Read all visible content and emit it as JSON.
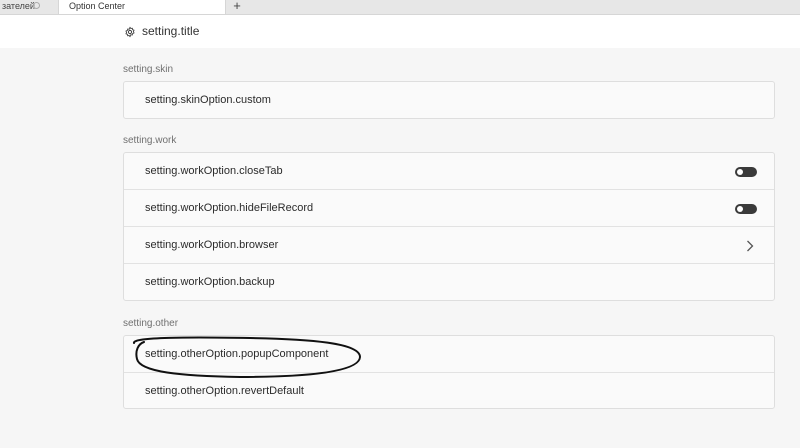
{
  "tabs": {
    "inactive_label": "зателей",
    "active_label": "Option Center",
    "new_tab_label": "+"
  },
  "header": {
    "title": "setting.title",
    "icon": "gear-icon"
  },
  "sections": {
    "skin": {
      "label": "setting.skin",
      "rows": [
        "setting.skinOption.custom"
      ]
    },
    "work": {
      "label": "setting.work",
      "rows": [
        {
          "label": "setting.workOption.closeTab",
          "control": "toggle",
          "state": "off"
        },
        {
          "label": "setting.workOption.hideFileRecord",
          "control": "toggle",
          "state": "off"
        },
        {
          "label": "setting.workOption.browser",
          "control": "chevron-right-icon"
        },
        {
          "label": "setting.workOption.backup",
          "control": "none"
        }
      ]
    },
    "other": {
      "label": "setting.other",
      "rows": [
        "setting.otherOption.popupComponent",
        "setting.otherOption.revertDefault"
      ]
    }
  },
  "colors": {
    "background": "#f6f6f6",
    "card": "#fafafa",
    "toggle": "#3a3a3a"
  }
}
